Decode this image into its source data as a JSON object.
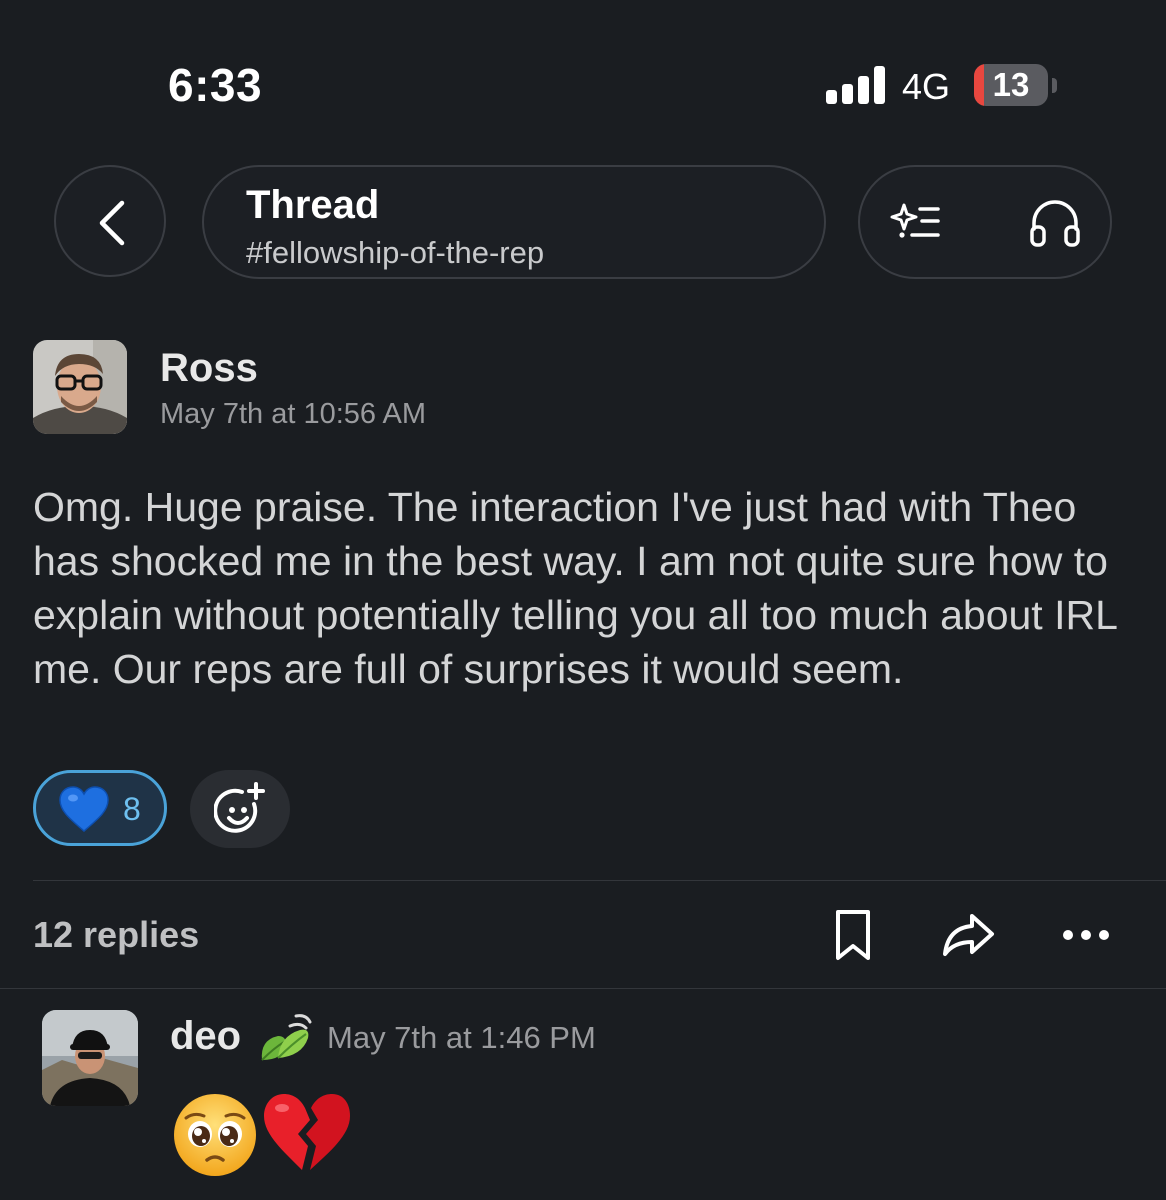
{
  "status_bar": {
    "time": "6:33",
    "network": "4G",
    "battery_percent": "13",
    "battery_level": 0.13,
    "signal_bars": 4
  },
  "header": {
    "back_icon": "chevron-left-icon",
    "title": "Thread",
    "channel": "#fellowship-of-the-rep",
    "ai_summary_icon": "sparkle-list-icon",
    "huddle_icon": "headphones-icon"
  },
  "post": {
    "author": "Ross",
    "timestamp": "May 7th at 10:56 AM",
    "body": "Omg. Huge praise. The interaction I've just had with Theo has shocked me in the best way. I am not quite sure how to explain without potentially telling you all too much about IRL me. Our reps are full of surprises it would seem.",
    "reaction": {
      "emoji": "blue-heart",
      "count": "8"
    },
    "add_reaction_icon": "add-emoji-icon"
  },
  "thread_bar": {
    "replies_label": "12 replies",
    "icons": [
      "bookmark-icon",
      "share-icon",
      "more-icon"
    ]
  },
  "reply": {
    "author": "deo",
    "status_emoji": "leaves-icon",
    "timestamp": "May 7th at 1:46 PM",
    "emojis": [
      "pleading-face",
      "broken-heart"
    ]
  },
  "colors": {
    "background": "#1a1d21",
    "reaction_border": "#4aa3d9",
    "reaction_bg": "#1f3347",
    "battery_low": "#e8473f"
  }
}
